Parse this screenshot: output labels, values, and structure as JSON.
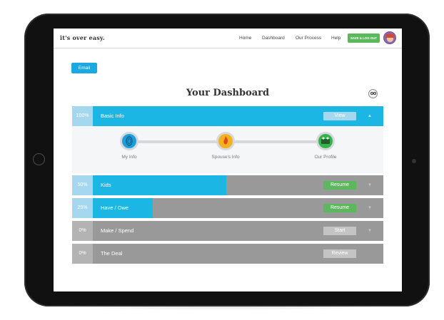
{
  "app": {
    "logo": "it's over easy.",
    "nav": [
      "Home",
      "Dashboard",
      "Our Process",
      "Help"
    ],
    "save_button": "SAVE & LOG OUT"
  },
  "email_button": "Email",
  "page_title": "Your Dashboard",
  "colors": {
    "accent_blue": "#1bb6e3",
    "blue_light": "#a5d7ee",
    "gray_row": "#999999",
    "gray_pct": "#b3b3b3",
    "green": "#5cb85c"
  },
  "sections": [
    {
      "percent": "100%",
      "progress": 1.0,
      "label": "Basic Info",
      "action": "View",
      "expanded": true
    },
    {
      "percent": "50%",
      "progress": 0.5,
      "label": "Kids",
      "action": "Resume"
    },
    {
      "percent": "25%",
      "progress": 0.25,
      "label": "Have / Owe",
      "action": "Resume"
    },
    {
      "percent": "0%",
      "progress": 0.0,
      "label": "Make / Spend",
      "action": "Start"
    },
    {
      "percent": "0%",
      "progress": 0.0,
      "label": "The Deal",
      "action": "Review"
    }
  ],
  "basic_info_steps": [
    {
      "label": "My Info",
      "color": "#1b9ed9",
      "icon": "fingerprint-icon"
    },
    {
      "label": "Spouse's Info",
      "color": "#f5b21e",
      "icon": "flame-icon"
    },
    {
      "label": "Our Profile",
      "color": "#35b24a",
      "icon": "family-icon"
    }
  ]
}
